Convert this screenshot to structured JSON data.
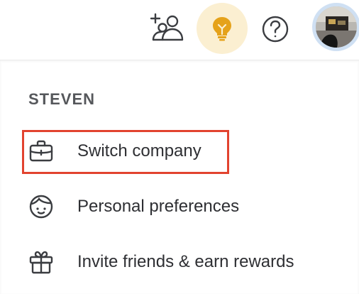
{
  "topbar": {
    "icons": {
      "add_user": "add-user-icon",
      "tips": "lightbulb-icon",
      "help": "question-mark-icon",
      "avatar": "user-avatar"
    },
    "colors": {
      "bulb_bg": "#fbefd1",
      "bulb": "#e5a21a",
      "avatar_ring": "#cfe0f3"
    }
  },
  "menu": {
    "section_title": "STEVEN",
    "items": [
      {
        "label": "Switch company",
        "icon": "briefcase-icon",
        "highlighted": true
      },
      {
        "label": "Personal preferences",
        "icon": "face-icon"
      },
      {
        "label": "Invite friends & earn rewards",
        "icon": "gift-icon"
      }
    ],
    "highlight_color": "#e2432f"
  }
}
